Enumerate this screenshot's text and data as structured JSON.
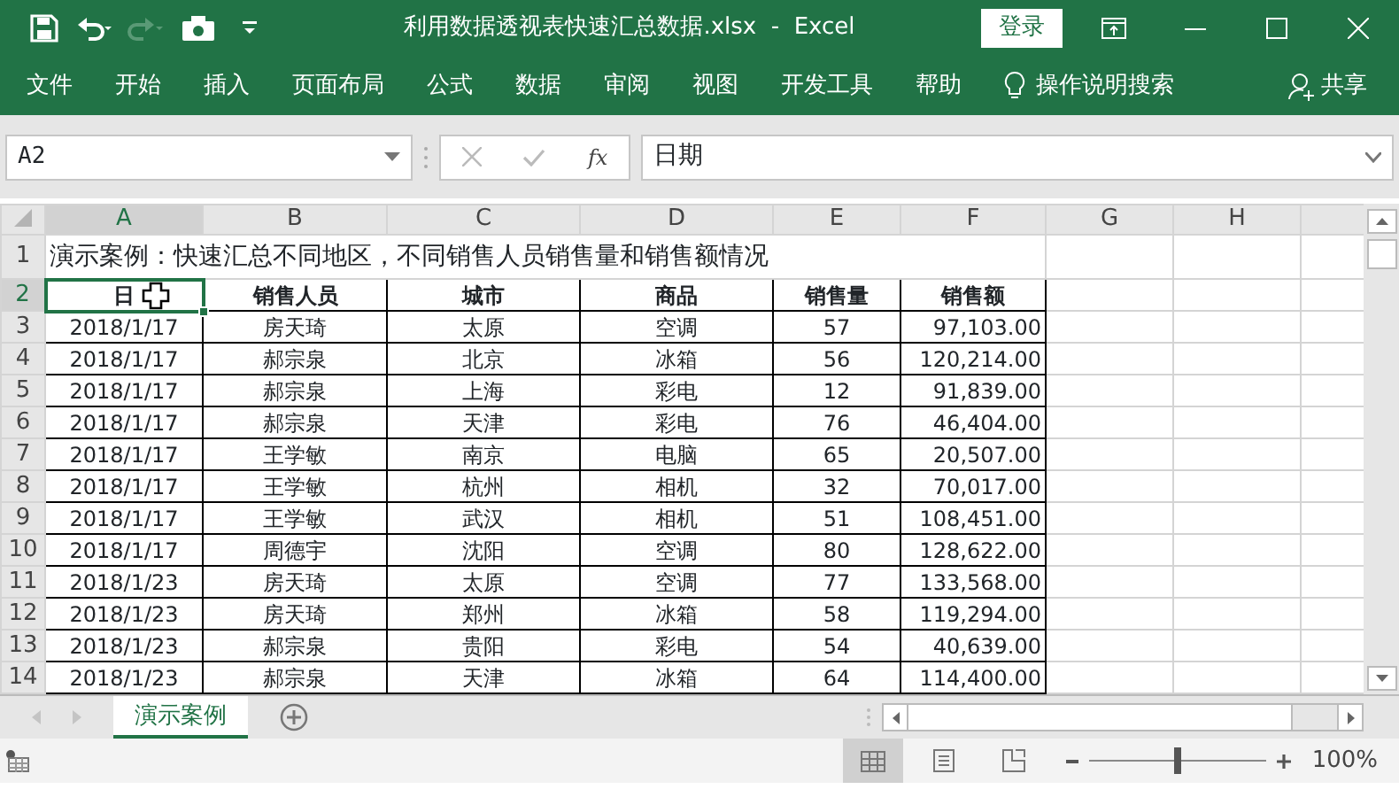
{
  "title_bar": {
    "quick_access": [
      {
        "kind": "save",
        "disabled": false
      },
      {
        "kind": "undo",
        "disabled": false
      },
      {
        "kind": "redo",
        "disabled": true
      },
      {
        "kind": "camera",
        "disabled": false
      },
      {
        "kind": "customize",
        "disabled": false
      }
    ],
    "title": "利用数据透视表快速汇总数据.xlsx  -  Excel",
    "login_button": "登录"
  },
  "ribbon_tabs": [
    {
      "label": "文件"
    },
    {
      "label": "开始"
    },
    {
      "label": "插入"
    },
    {
      "label": "页面布局"
    },
    {
      "label": "公式"
    },
    {
      "label": "数据"
    },
    {
      "label": "审阅"
    },
    {
      "label": "视图"
    },
    {
      "label": "开发工具"
    },
    {
      "label": "帮助"
    }
  ],
  "tell_me": "操作说明搜索",
  "share": "共享",
  "formula_bar": {
    "name_box": "A2",
    "fx_label": "fx",
    "formula": "日期"
  },
  "columns": [
    {
      "label": "A",
      "selected": true
    },
    {
      "label": "B",
      "selected": false
    },
    {
      "label": "C",
      "selected": false
    },
    {
      "label": "D",
      "selected": false
    },
    {
      "label": "E",
      "selected": false
    },
    {
      "label": "F",
      "selected": false
    },
    {
      "label": "G",
      "selected": false
    },
    {
      "label": "H",
      "selected": false
    }
  ],
  "row_headers": [
    {
      "label": "1",
      "selected": false
    },
    {
      "label": "2",
      "selected": true
    },
    {
      "label": "3",
      "selected": false
    },
    {
      "label": "4",
      "selected": false
    },
    {
      "label": "5",
      "selected": false
    },
    {
      "label": "6",
      "selected": false
    },
    {
      "label": "7",
      "selected": false
    },
    {
      "label": "8",
      "selected": false
    },
    {
      "label": "9",
      "selected": false
    },
    {
      "label": "10",
      "selected": false
    },
    {
      "label": "11",
      "selected": false
    },
    {
      "label": "12",
      "selected": false
    },
    {
      "label": "13",
      "selected": false
    },
    {
      "label": "14",
      "selected": false
    }
  ],
  "sheet_title": "演示案例：快速汇总不同地区，不同销售人员销售量和销售额情况",
  "table": {
    "header": [
      "日",
      "销售人员",
      "城市",
      "商品",
      "销售量",
      "销售额"
    ],
    "rows": [
      [
        "2018/1/17",
        "房天琦",
        "太原",
        "空调",
        "57",
        "97,103.00"
      ],
      [
        "2018/1/17",
        "郝宗泉",
        "北京",
        "冰箱",
        "56",
        "120,214.00"
      ],
      [
        "2018/1/17",
        "郝宗泉",
        "上海",
        "彩电",
        "12",
        "91,839.00"
      ],
      [
        "2018/1/17",
        "郝宗泉",
        "天津",
        "彩电",
        "76",
        "46,404.00"
      ],
      [
        "2018/1/17",
        "王学敏",
        "南京",
        "电脑",
        "65",
        "20,507.00"
      ],
      [
        "2018/1/17",
        "王学敏",
        "杭州",
        "相机",
        "32",
        "70,017.00"
      ],
      [
        "2018/1/17",
        "王学敏",
        "武汉",
        "相机",
        "51",
        "108,451.00"
      ],
      [
        "2018/1/17",
        "周德宇",
        "沈阳",
        "空调",
        "80",
        "128,622.00"
      ],
      [
        "2018/1/23",
        "房天琦",
        "太原",
        "空调",
        "77",
        "133,568.00"
      ],
      [
        "2018/1/23",
        "房天琦",
        "郑州",
        "冰箱",
        "58",
        "119,294.00"
      ],
      [
        "2018/1/23",
        "郝宗泉",
        "贵阳",
        "彩电",
        "54",
        "40,639.00"
      ],
      [
        "2018/1/23",
        "郝宗泉",
        "天津",
        "冰箱",
        "64",
        "114,400.00"
      ]
    ]
  },
  "sheet_tabs": [
    {
      "label": "演示案例",
      "selected": true
    }
  ],
  "status_bar": {
    "views": [
      {
        "kind": "normal",
        "selected": true
      },
      {
        "kind": "page_layout",
        "selected": false
      },
      {
        "kind": "page_break",
        "selected": false
      }
    ],
    "zoom": {
      "level": 0.5
    },
    "zoom_text": "100%"
  }
}
